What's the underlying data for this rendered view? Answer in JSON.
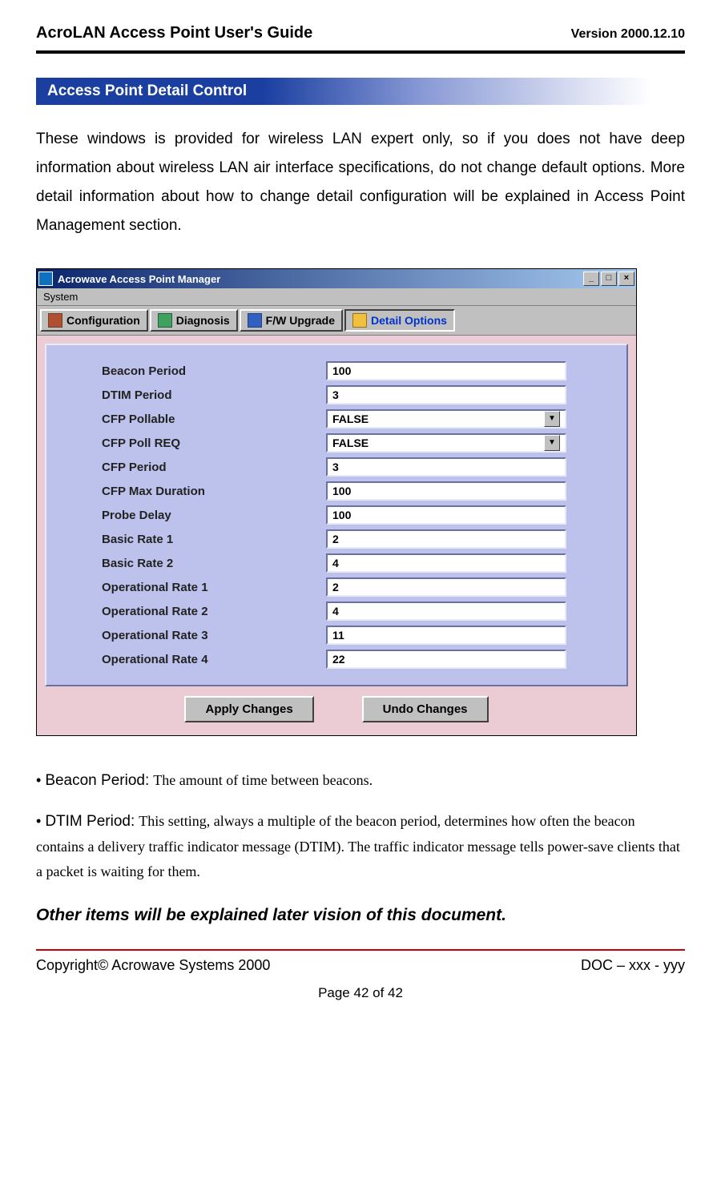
{
  "header": {
    "title_left": "AcroLAN Access Point User's Guide",
    "title_right": "Version 2000.12.10"
  },
  "section_title": "Access Point Detail Control",
  "intro_text": "These windows is provided for wireless LAN expert only, so if you does not have deep information about wireless LAN air interface specifications, do not change default options. More detail information about how to change detail configuration will be explained in Access Point Management section.",
  "window": {
    "title": "Acrowave Access Point Manager",
    "menu": "System",
    "tabs": [
      {
        "label": "Configuration",
        "active": false
      },
      {
        "label": "Diagnosis",
        "active": false
      },
      {
        "label": "F/W Upgrade",
        "active": false
      },
      {
        "label": "Detail Options",
        "active": true
      }
    ],
    "fields": [
      {
        "label": "Beacon Period",
        "value": "100",
        "type": "text"
      },
      {
        "label": "DTIM Period",
        "value": "3",
        "type": "text"
      },
      {
        "label": "CFP Pollable",
        "value": "FALSE",
        "type": "select"
      },
      {
        "label": "CFP Poll REQ",
        "value": "FALSE",
        "type": "select"
      },
      {
        "label": "CFP Period",
        "value": "3",
        "type": "text"
      },
      {
        "label": "CFP Max Duration",
        "value": "100",
        "type": "text"
      },
      {
        "label": "Probe Delay",
        "value": "100",
        "type": "text"
      },
      {
        "label": "Basic Rate 1",
        "value": "2",
        "type": "text"
      },
      {
        "label": "Basic Rate 2",
        "value": "4",
        "type": "text"
      },
      {
        "label": "Operational Rate 1",
        "value": "2",
        "type": "text"
      },
      {
        "label": "Operational Rate 2",
        "value": "4",
        "type": "text"
      },
      {
        "label": "Operational Rate 3",
        "value": "11",
        "type": "text"
      },
      {
        "label": "Operational Rate 4",
        "value": "22",
        "type": "text"
      }
    ],
    "buttons": {
      "apply": "Apply Changes",
      "undo": "Undo Changes"
    },
    "winbtn_min": "_",
    "winbtn_max": "□",
    "winbtn_close": "×"
  },
  "definitions": [
    {
      "term": "Beacon Period:",
      "desc": "The amount of time between beacons."
    },
    {
      "term": "DTIM Period:",
      "desc": "This setting, always a multiple of the beacon period, determines how often the beacon contains a delivery traffic indicator message (DTIM). The traffic indicator message tells power-save clients that a packet is waiting for them."
    }
  ],
  "note_text": "Other items will be explained later vision of this document.",
  "footer": {
    "left": "Copyright© Acrowave Systems 2000",
    "right": "DOC – xxx - yyy",
    "page": "Page 42 of 42"
  }
}
